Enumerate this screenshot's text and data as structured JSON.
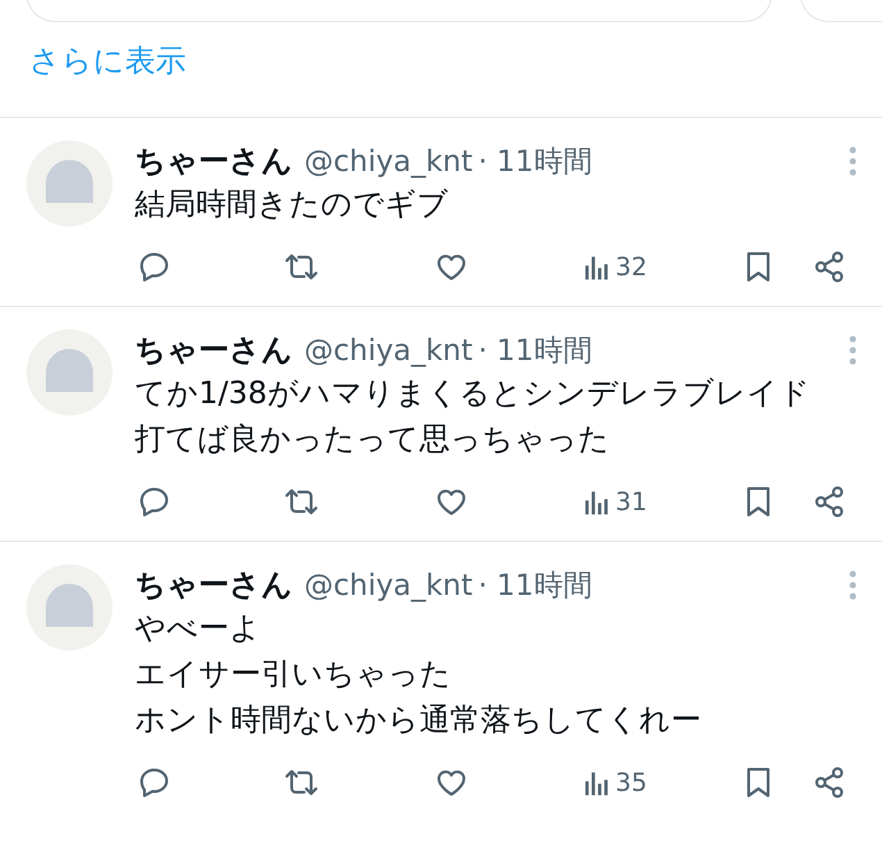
{
  "show_more": {
    "label": "さらに表示"
  },
  "tweets": [
    {
      "name": "ちゃーさん",
      "handle": "@chiya_knt",
      "time": "· 11時間",
      "lines": [
        "結局時間きたのでギブ"
      ],
      "views": "32"
    },
    {
      "name": "ちゃーさん",
      "handle": "@chiya_knt",
      "time": "· 11時間",
      "lines": [
        "てか1/38がハマりまくるとシンデレラブレイド",
        "打てば良かったって思っちゃった"
      ],
      "views": "31"
    },
    {
      "name": "ちゃーさん",
      "handle": "@chiya_knt",
      "time": "· 11時間",
      "lines": [
        "やべーよ",
        "エイサー引いちゃった",
        "ホント時間ないから通常落ちしてくれー"
      ],
      "views": "35"
    }
  ]
}
